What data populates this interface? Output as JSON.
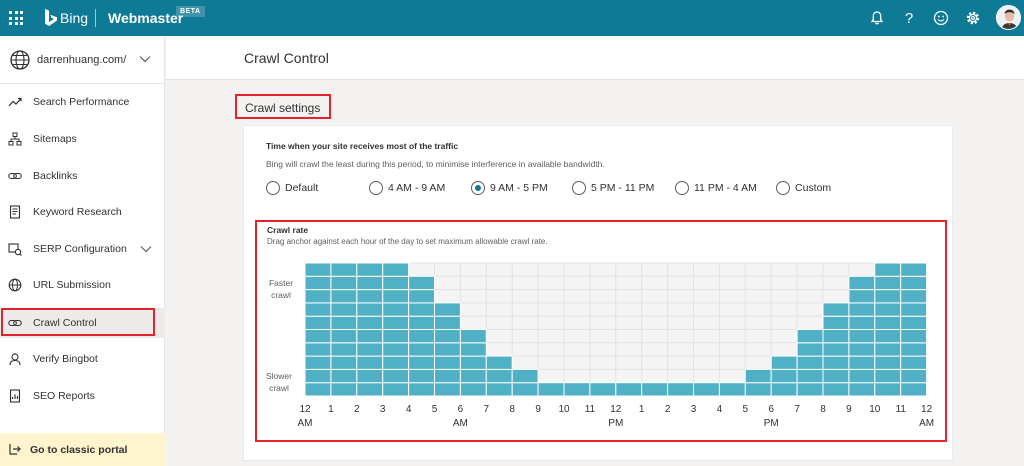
{
  "topbar": {
    "brand": "Bing",
    "product": "Webmaster",
    "badge": "BETA",
    "icons": [
      "waffle-icon",
      "bing-logo-icon",
      "bell-icon",
      "help-icon",
      "smiley-icon",
      "gear-icon",
      "avatar"
    ]
  },
  "sidebar": {
    "site": "darrenhuang.com/",
    "items": [
      {
        "label": "Search Performance",
        "icon": "trend-icon"
      },
      {
        "label": "Sitemaps",
        "icon": "sitemap-icon"
      },
      {
        "label": "Backlinks",
        "icon": "link-icon"
      },
      {
        "label": "Keyword Research",
        "icon": "document-icon"
      },
      {
        "label": "SERP Configuration",
        "icon": "serp-icon"
      },
      {
        "label": "URL Submission",
        "icon": "globe-icon"
      },
      {
        "label": "Crawl Control",
        "icon": "link-icon"
      },
      {
        "label": "Verify Bingbot",
        "icon": "bot-icon"
      },
      {
        "label": "SEO Reports",
        "icon": "report-icon"
      }
    ],
    "classic": "Go to classic portal"
  },
  "page": {
    "title": "Crawl Control",
    "section_title": "Crawl settings"
  },
  "traffic": {
    "heading": "Time when your site receives most of the traffic",
    "description": "Bing will crawl the least during this period, to minimise interference in available bandwidth.",
    "options": [
      "Default",
      "4 AM - 9 AM",
      "9 AM - 5 PM",
      "5 PM - 11 PM",
      "11 PM - 4 AM",
      "Custom"
    ],
    "selected": "9 AM - 5 PM"
  },
  "crawl_rate": {
    "title": "Crawl rate",
    "description": "Drag anchor against each hour of the day to set maximum allowable crawl rate.",
    "faster_label": "Faster crawl",
    "slower_label": "Slower crawl"
  },
  "chart_data": {
    "type": "bar",
    "categories": [
      "12 AM",
      "1",
      "2",
      "3",
      "4",
      "5",
      "6 AM",
      "7",
      "8",
      "9",
      "10",
      "11",
      "12 PM",
      "1",
      "2",
      "3",
      "4",
      "5",
      "6 PM",
      "7",
      "8",
      "9",
      "10",
      "11"
    ],
    "tick_labels": [
      {
        "hour": "12",
        "period": "AM"
      },
      {
        "hour": "1",
        "period": ""
      },
      {
        "hour": "2",
        "period": ""
      },
      {
        "hour": "3",
        "period": ""
      },
      {
        "hour": "4",
        "period": ""
      },
      {
        "hour": "5",
        "period": ""
      },
      {
        "hour": "6",
        "period": "AM"
      },
      {
        "hour": "7",
        "period": ""
      },
      {
        "hour": "8",
        "period": ""
      },
      {
        "hour": "9",
        "period": ""
      },
      {
        "hour": "10",
        "period": ""
      },
      {
        "hour": "11",
        "period": ""
      },
      {
        "hour": "12",
        "period": "PM"
      },
      {
        "hour": "1",
        "period": ""
      },
      {
        "hour": "2",
        "period": ""
      },
      {
        "hour": "3",
        "period": ""
      },
      {
        "hour": "4",
        "period": ""
      },
      {
        "hour": "5",
        "period": ""
      },
      {
        "hour": "6",
        "period": "PM"
      },
      {
        "hour": "7",
        "period": ""
      },
      {
        "hour": "8",
        "period": ""
      },
      {
        "hour": "9",
        "period": ""
      },
      {
        "hour": "10",
        "period": ""
      },
      {
        "hour": "11",
        "period": ""
      },
      {
        "hour": "12",
        "period": "AM"
      }
    ],
    "values": [
      10,
      10,
      10,
      10,
      9,
      7,
      5,
      3,
      2,
      1,
      1,
      1,
      1,
      1,
      1,
      1,
      1,
      2,
      3,
      5,
      7,
      9,
      10,
      10
    ],
    "ylim": [
      0,
      10
    ],
    "bar_color": "#4fb0c6",
    "grid": true
  }
}
